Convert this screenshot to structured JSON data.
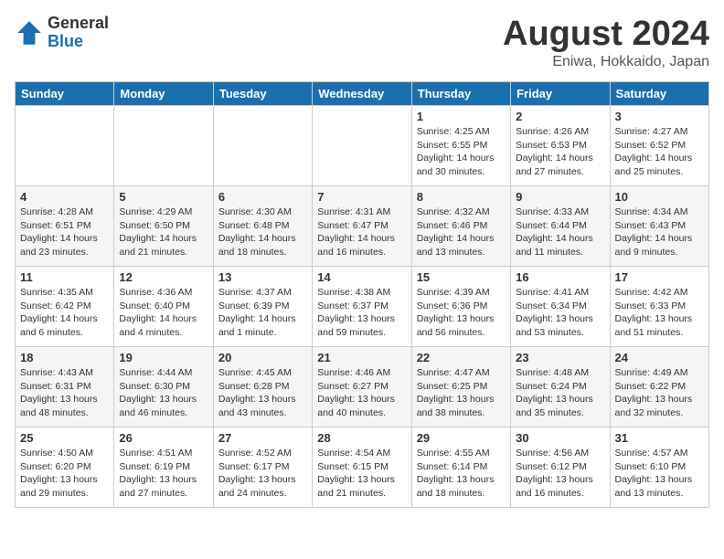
{
  "logo": {
    "general": "General",
    "blue": "Blue"
  },
  "header": {
    "month_year": "August 2024",
    "location": "Eniwa, Hokkaido, Japan"
  },
  "weekdays": [
    "Sunday",
    "Monday",
    "Tuesday",
    "Wednesday",
    "Thursday",
    "Friday",
    "Saturday"
  ],
  "weeks": [
    [
      {
        "day": "",
        "info": ""
      },
      {
        "day": "",
        "info": ""
      },
      {
        "day": "",
        "info": ""
      },
      {
        "day": "",
        "info": ""
      },
      {
        "day": "1",
        "info": "Sunrise: 4:25 AM\nSunset: 6:55 PM\nDaylight: 14 hours\nand 30 minutes."
      },
      {
        "day": "2",
        "info": "Sunrise: 4:26 AM\nSunset: 6:53 PM\nDaylight: 14 hours\nand 27 minutes."
      },
      {
        "day": "3",
        "info": "Sunrise: 4:27 AM\nSunset: 6:52 PM\nDaylight: 14 hours\nand 25 minutes."
      }
    ],
    [
      {
        "day": "4",
        "info": "Sunrise: 4:28 AM\nSunset: 6:51 PM\nDaylight: 14 hours\nand 23 minutes."
      },
      {
        "day": "5",
        "info": "Sunrise: 4:29 AM\nSunset: 6:50 PM\nDaylight: 14 hours\nand 21 minutes."
      },
      {
        "day": "6",
        "info": "Sunrise: 4:30 AM\nSunset: 6:48 PM\nDaylight: 14 hours\nand 18 minutes."
      },
      {
        "day": "7",
        "info": "Sunrise: 4:31 AM\nSunset: 6:47 PM\nDaylight: 14 hours\nand 16 minutes."
      },
      {
        "day": "8",
        "info": "Sunrise: 4:32 AM\nSunset: 6:46 PM\nDaylight: 14 hours\nand 13 minutes."
      },
      {
        "day": "9",
        "info": "Sunrise: 4:33 AM\nSunset: 6:44 PM\nDaylight: 14 hours\nand 11 minutes."
      },
      {
        "day": "10",
        "info": "Sunrise: 4:34 AM\nSunset: 6:43 PM\nDaylight: 14 hours\nand 9 minutes."
      }
    ],
    [
      {
        "day": "11",
        "info": "Sunrise: 4:35 AM\nSunset: 6:42 PM\nDaylight: 14 hours\nand 6 minutes."
      },
      {
        "day": "12",
        "info": "Sunrise: 4:36 AM\nSunset: 6:40 PM\nDaylight: 14 hours\nand 4 minutes."
      },
      {
        "day": "13",
        "info": "Sunrise: 4:37 AM\nSunset: 6:39 PM\nDaylight: 14 hours\nand 1 minute."
      },
      {
        "day": "14",
        "info": "Sunrise: 4:38 AM\nSunset: 6:37 PM\nDaylight: 13 hours\nand 59 minutes."
      },
      {
        "day": "15",
        "info": "Sunrise: 4:39 AM\nSunset: 6:36 PM\nDaylight: 13 hours\nand 56 minutes."
      },
      {
        "day": "16",
        "info": "Sunrise: 4:41 AM\nSunset: 6:34 PM\nDaylight: 13 hours\nand 53 minutes."
      },
      {
        "day": "17",
        "info": "Sunrise: 4:42 AM\nSunset: 6:33 PM\nDaylight: 13 hours\nand 51 minutes."
      }
    ],
    [
      {
        "day": "18",
        "info": "Sunrise: 4:43 AM\nSunset: 6:31 PM\nDaylight: 13 hours\nand 48 minutes."
      },
      {
        "day": "19",
        "info": "Sunrise: 4:44 AM\nSunset: 6:30 PM\nDaylight: 13 hours\nand 46 minutes."
      },
      {
        "day": "20",
        "info": "Sunrise: 4:45 AM\nSunset: 6:28 PM\nDaylight: 13 hours\nand 43 minutes."
      },
      {
        "day": "21",
        "info": "Sunrise: 4:46 AM\nSunset: 6:27 PM\nDaylight: 13 hours\nand 40 minutes."
      },
      {
        "day": "22",
        "info": "Sunrise: 4:47 AM\nSunset: 6:25 PM\nDaylight: 13 hours\nand 38 minutes."
      },
      {
        "day": "23",
        "info": "Sunrise: 4:48 AM\nSunset: 6:24 PM\nDaylight: 13 hours\nand 35 minutes."
      },
      {
        "day": "24",
        "info": "Sunrise: 4:49 AM\nSunset: 6:22 PM\nDaylight: 13 hours\nand 32 minutes."
      }
    ],
    [
      {
        "day": "25",
        "info": "Sunrise: 4:50 AM\nSunset: 6:20 PM\nDaylight: 13 hours\nand 29 minutes."
      },
      {
        "day": "26",
        "info": "Sunrise: 4:51 AM\nSunset: 6:19 PM\nDaylight: 13 hours\nand 27 minutes."
      },
      {
        "day": "27",
        "info": "Sunrise: 4:52 AM\nSunset: 6:17 PM\nDaylight: 13 hours\nand 24 minutes."
      },
      {
        "day": "28",
        "info": "Sunrise: 4:54 AM\nSunset: 6:15 PM\nDaylight: 13 hours\nand 21 minutes."
      },
      {
        "day": "29",
        "info": "Sunrise: 4:55 AM\nSunset: 6:14 PM\nDaylight: 13 hours\nand 18 minutes."
      },
      {
        "day": "30",
        "info": "Sunrise: 4:56 AM\nSunset: 6:12 PM\nDaylight: 13 hours\nand 16 minutes."
      },
      {
        "day": "31",
        "info": "Sunrise: 4:57 AM\nSunset: 6:10 PM\nDaylight: 13 hours\nand 13 minutes."
      }
    ]
  ]
}
